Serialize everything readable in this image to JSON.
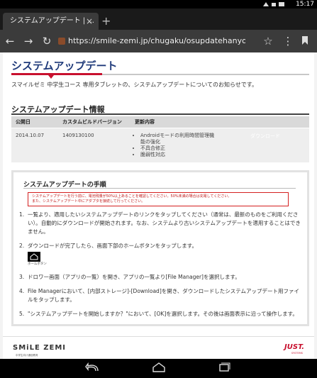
{
  "status": {
    "time": "15:17"
  },
  "browser": {
    "tab_title": "システムアップデート | ...",
    "tab_close": "×",
    "new_tab": "+",
    "url": "https://smile-zemi.jp/chugaku/osupdatehanyo/"
  },
  "page": {
    "title": "システムアップデート",
    "intro": "スマイルゼミ 中学生コース 専用タブレットの、システムアップデートについてのお知らせです。",
    "info_heading": "システムアップデート情報",
    "table": {
      "headers": [
        "公開日",
        "カスタムビルドバージョン",
        "更新内容",
        ""
      ],
      "row": {
        "date": "2014.10.07",
        "version": "1409130100",
        "changes": [
          "Androidモードの利用時間管理機能の強化",
          "不具合修正",
          "脆弱性対応"
        ],
        "download": "ダウンロード"
      }
    },
    "procedure": {
      "title": "システムアップデートの手順",
      "warning_line1": "システムアップデートを行う前に、電池残量が50%以上あることを確認してください。50%未満の場合は充電してください。",
      "warning_line2": "また、システムアップデート中にアダプタを接続して行ってください。",
      "steps": [
        {
          "num": "1.",
          "text": "一覧より、適用したいシステムアップデートのリンクをタップしてください（通常は、最新のものをご利用ください）。自動的にダウンロードが開始されます。なお、システムより古いシステムアップデートを適用することはできません。"
        },
        {
          "num": "2.",
          "text": "ダウンロードが完了したら、画面下部のホームボタンをタップします。"
        },
        {
          "num": "3.",
          "text": "ドロワー画面（アプリの一覧）を開き、アプリの一覧より[File Manager]を選択します。"
        },
        {
          "num": "4.",
          "text": "File Managerにおいて、[内部ストレージ]-[Download]を開き、ダウンロードしたシステムアップデート用ファイルをタップします。"
        },
        {
          "num": "5.",
          "text": "\"システムアップデートを開始しますか？\"において、[OK]を選択します。その後は画面表示に沿って操作します。"
        }
      ],
      "home_label": "ホームボタン"
    },
    "footer": {
      "logo": "SMiLE ZEMI",
      "logo_sub": "中学生向け通信教育",
      "just": "JUST.",
      "just_sub": "SYSTEMS"
    }
  },
  "colors": {
    "accent": "#c8102e",
    "title": "#1f3a7a"
  }
}
